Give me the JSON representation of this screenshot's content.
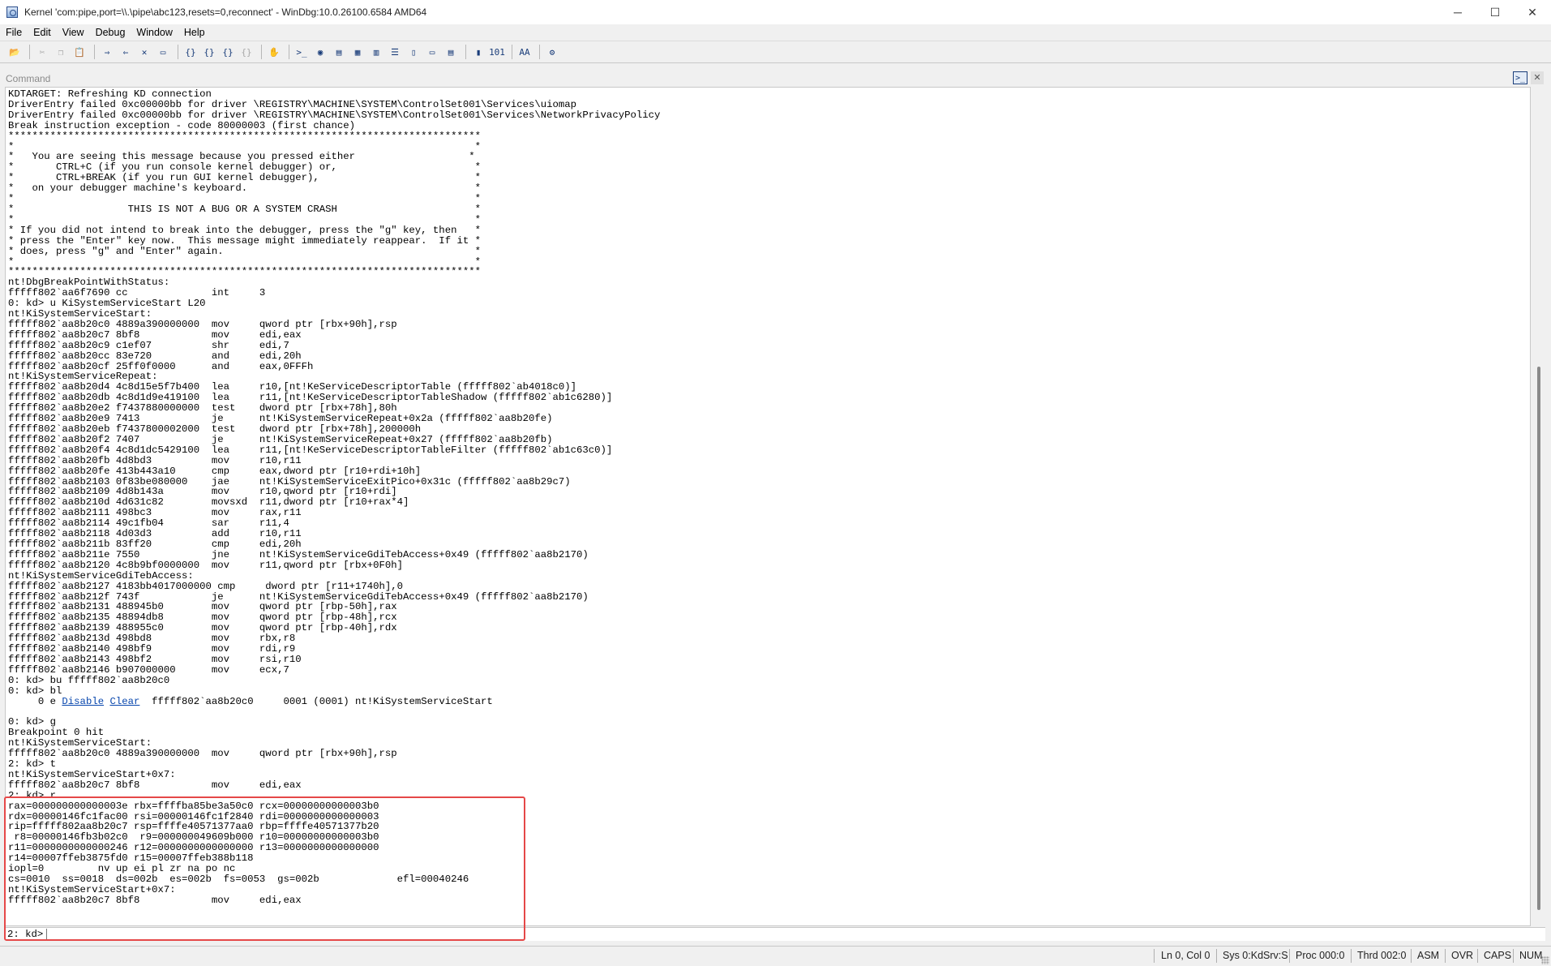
{
  "window": {
    "title": "Kernel 'com:pipe,port=\\\\.\\pipe\\abc123,resets=0,reconnect' - WinDbg:10.0.26100.6584 AMD64",
    "minimize": "─",
    "maximize": "☐",
    "close": "✕"
  },
  "menu": [
    "File",
    "Edit",
    "View",
    "Debug",
    "Window",
    "Help"
  ],
  "toolbar": {
    "icons": [
      "open-icon",
      "cut-icon",
      "copy-icon",
      "paste-icon",
      "insert-breakpoint-icon",
      "remove-breakpoint-icon",
      "break-icon",
      "stop-debugging-icon",
      "step-into-icon",
      "step-over-icon",
      "step-out-icon",
      "run-to-cursor-icon",
      "hand-icon",
      "command-window-icon",
      "watch-icon",
      "locals-icon",
      "registers-icon",
      "memory-icon",
      "call-stack-icon",
      "disassembly-icon",
      "scratch-pad-icon",
      "processes-threads-icon",
      "source-mode-icon",
      "hex-mode-icon",
      "font-icon",
      "options-icon"
    ],
    "glyphs": [
      "📂",
      "✂",
      "❐",
      "📋",
      "⇒",
      "⇐",
      "✕",
      "▭",
      "{}",
      "{}",
      "{}",
      "{}",
      "✋",
      ">_",
      "◉",
      "▤",
      "▦",
      "▥",
      "☰",
      "▯",
      "▭",
      "▤",
      "▮",
      "101",
      "AA",
      "⚙"
    ]
  },
  "command_window": {
    "title": "Command",
    "output_lines": [
      "KDTARGET: Refreshing KD connection",
      "DriverEntry failed 0xc00000bb for driver \\REGISTRY\\MACHINE\\SYSTEM\\ControlSet001\\Services\\uiomap",
      "DriverEntry failed 0xc00000bb for driver \\REGISTRY\\MACHINE\\SYSTEM\\ControlSet001\\Services\\NetworkPrivacyPolicy",
      "Break instruction exception - code 80000003 (first chance)",
      "*******************************************************************************",
      "*                                                                             *",
      "*   You are seeing this message because you pressed either                   *",
      "*       CTRL+C (if you run console kernel debugger) or,                       *",
      "*       CTRL+BREAK (if you run GUI kernel debugger),                          *",
      "*   on your debugger machine's keyboard.                                      *",
      "*                                                                             *",
      "*                   THIS IS NOT A BUG OR A SYSTEM CRASH                       *",
      "*                                                                             *",
      "* If you did not intend to break into the debugger, press the \"g\" key, then   *",
      "* press the \"Enter\" key now.  This message might immediately reappear.  If it *",
      "* does, press \"g\" and \"Enter\" again.                                          *",
      "*                                                                             *",
      "*******************************************************************************",
      "nt!DbgBreakPointWithStatus:",
      "fffff802`aa6f7690 cc              int     3",
      "0: kd> u KiSystemServiceStart L20",
      "nt!KiSystemServiceStart:",
      "fffff802`aa8b20c0 4889a390000000  mov     qword ptr [rbx+90h],rsp",
      "fffff802`aa8b20c7 8bf8            mov     edi,eax",
      "fffff802`aa8b20c9 c1ef07          shr     edi,7",
      "fffff802`aa8b20cc 83e720          and     edi,20h",
      "fffff802`aa8b20cf 25ff0f0000      and     eax,0FFFh",
      "nt!KiSystemServiceRepeat:",
      "fffff802`aa8b20d4 4c8d15e5f7b400  lea     r10,[nt!KeServiceDescriptorTable (fffff802`ab4018c0)]",
      "fffff802`aa8b20db 4c8d1d9e419100  lea     r11,[nt!KeServiceDescriptorTableShadow (fffff802`ab1c6280)]",
      "fffff802`aa8b20e2 f7437880000000  test    dword ptr [rbx+78h],80h",
      "fffff802`aa8b20e9 7413            je      nt!KiSystemServiceRepeat+0x2a (fffff802`aa8b20fe)",
      "fffff802`aa8b20eb f7437800002000  test    dword ptr [rbx+78h],200000h",
      "fffff802`aa8b20f2 7407            je      nt!KiSystemServiceRepeat+0x27 (fffff802`aa8b20fb)",
      "fffff802`aa8b20f4 4c8d1dc5429100  lea     r11,[nt!KeServiceDescriptorTableFilter (fffff802`ab1c63c0)]",
      "fffff802`aa8b20fb 4d8bd3          mov     r10,r11",
      "fffff802`aa8b20fe 413b443a10      cmp     eax,dword ptr [r10+rdi+10h]",
      "fffff802`aa8b2103 0f83be080000    jae     nt!KiSystemServiceExitPico+0x31c (fffff802`aa8b29c7)",
      "fffff802`aa8b2109 4d8b143a        mov     r10,qword ptr [r10+rdi]",
      "fffff802`aa8b210d 4d631c82        movsxd  r11,dword ptr [r10+rax*4]",
      "fffff802`aa8b2111 498bc3          mov     rax,r11",
      "fffff802`aa8b2114 49c1fb04        sar     r11,4",
      "fffff802`aa8b2118 4d03d3          add     r10,r11",
      "fffff802`aa8b211b 83ff20          cmp     edi,20h",
      "fffff802`aa8b211e 7550            jne     nt!KiSystemServiceGdiTebAccess+0x49 (fffff802`aa8b2170)",
      "fffff802`aa8b2120 4c8b9bf0000000  mov     r11,qword ptr [rbx+0F0h]",
      "nt!KiSystemServiceGdiTebAccess:",
      "fffff802`aa8b2127 4183bb4017000000 cmp     dword ptr [r11+1740h],0",
      "fffff802`aa8b212f 743f            je      nt!KiSystemServiceGdiTebAccess+0x49 (fffff802`aa8b2170)",
      "fffff802`aa8b2131 488945b0        mov     qword ptr [rbp-50h],rax",
      "fffff802`aa8b2135 48894db8        mov     qword ptr [rbp-48h],rcx",
      "fffff802`aa8b2139 488955c0        mov     qword ptr [rbp-40h],rdx",
      "fffff802`aa8b213d 498bd8          mov     rbx,r8",
      "fffff802`aa8b2140 498bf9          mov     rdi,r9",
      "fffff802`aa8b2143 498bf2          mov     rsi,r10",
      "fffff802`aa8b2146 b907000000      mov     ecx,7",
      "0: kd> bu fffff802`aa8b20c0",
      "0: kd> bl"
    ],
    "bp_line": {
      "prefix": "     0 e ",
      "disable_link": "Disable",
      "clear_link": "Clear",
      "suffix": "  fffff802`aa8b20c0     0001 (0001) nt!KiSystemServiceStart"
    },
    "output_lines_2": [
      "",
      "0: kd> g",
      "Breakpoint 0 hit",
      "nt!KiSystemServiceStart:",
      "fffff802`aa8b20c0 4889a390000000  mov     qword ptr [rbx+90h],rsp",
      "2: kd> t",
      "nt!KiSystemServiceStart+0x7:",
      "fffff802`aa8b20c7 8bf8            mov     edi,eax",
      "2: kd> r",
      "rax=000000000000003e rbx=ffffba85be3a50c0 rcx=00000000000003b0",
      "rdx=00000146fc1fac00 rsi=00000146fc1f2840 rdi=0000000000000003",
      "rip=fffff802aa8b20c7 rsp=ffffe40571377aa0 rbp=ffffe40571377b20",
      " r8=00000146fb3b02c0  r9=000000049609b000 r10=00000000000003b0",
      "r11=0000000000000246 r12=0000000000000000 r13=0000000000000000",
      "r14=00007ffeb3875fd0 r15=00007ffeb388b118",
      "iopl=0         nv up ei pl zr na po nc",
      "cs=0010  ss=0018  ds=002b  es=002b  fs=0053  gs=002b             efl=00040246",
      "nt!KiSystemServiceStart+0x7:",
      "fffff802`aa8b20c7 8bf8            mov     edi,eax"
    ],
    "prompt": "2: kd>",
    "input_value": ""
  },
  "status_bar": {
    "position": "Ln 0, Col 0",
    "sys": "Sys 0:KdSrv:S",
    "proc": "Proc 000:0",
    "thrd": "Thrd 002:0",
    "asm": "ASM",
    "ovr": "OVR",
    "caps": "CAPS",
    "num": "NUM"
  },
  "colors": {
    "highlight_box": "#e54848",
    "link": "#0645ad"
  }
}
